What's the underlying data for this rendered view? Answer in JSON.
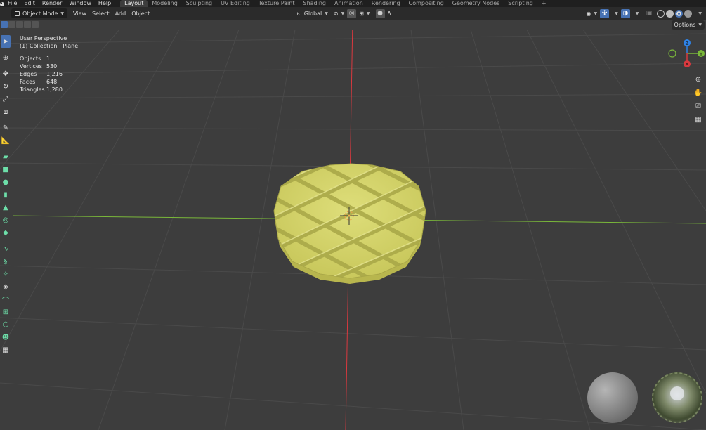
{
  "menu": [
    "File",
    "Edit",
    "Render",
    "Window",
    "Help"
  ],
  "workspaces": [
    "Layout",
    "Modeling",
    "Sculpting",
    "UV Editing",
    "Texture Paint",
    "Shading",
    "Animation",
    "Rendering",
    "Compositing",
    "Geometry Nodes",
    "Scripting"
  ],
  "active_workspace": "Layout",
  "header": {
    "mode": "Object Mode",
    "view": "View",
    "select": "Select",
    "add": "Add",
    "object": "Object",
    "transform_orientation": "Global",
    "add_workspace": "+"
  },
  "options_label": "Options",
  "viewport": {
    "perspective": "User Perspective",
    "collection": "(1) Collection | Plane",
    "stats": [
      {
        "label": "Objects",
        "value": "1"
      },
      {
        "label": "Vertices",
        "value": "530"
      },
      {
        "label": "Edges",
        "value": "1,216"
      },
      {
        "label": "Faces",
        "value": "648"
      },
      {
        "label": "Triangles",
        "value": "1,280"
      }
    ]
  },
  "gizmo": {
    "z": "Z",
    "y": "Y",
    "x": "X"
  },
  "colors": {
    "accent": "#4772b3",
    "waffle": "#d6d66a",
    "x_axis": "#d9393f",
    "y_axis": "#7ab83a",
    "z_axis": "#2f83e6",
    "bg": "#3d3d3d"
  },
  "icons": {
    "blender_logo": "blender-logo-icon",
    "zoom": "zoom-icon",
    "pan": "hand-icon",
    "camera": "camera-icon",
    "grid": "grid-icon"
  }
}
